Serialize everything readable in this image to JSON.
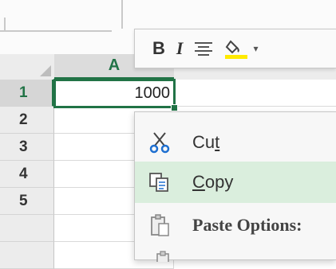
{
  "columns": [
    {
      "label": "A"
    }
  ],
  "rows": [
    "1",
    "2",
    "3",
    "4",
    "5"
  ],
  "active_cell": {
    "value": "1000"
  },
  "mini_toolbar": {
    "bold": "B",
    "italic": "I",
    "dropdown_arrow": "▾",
    "icons": [
      "align-center-icon",
      "fill-color-icon"
    ]
  },
  "context_menu": {
    "items": [
      {
        "label": "Cut",
        "underline_index": 2,
        "icon": "scissors-icon"
      },
      {
        "label": "Copy",
        "underline_index": 0,
        "icon": "copy-icon"
      },
      {
        "label": "Paste Options:",
        "icon": "clipboard-icon"
      }
    ]
  },
  "colors": {
    "excel_green": "#217346",
    "highlight": "#daeedd",
    "fill_yellow": "#ffea00"
  }
}
